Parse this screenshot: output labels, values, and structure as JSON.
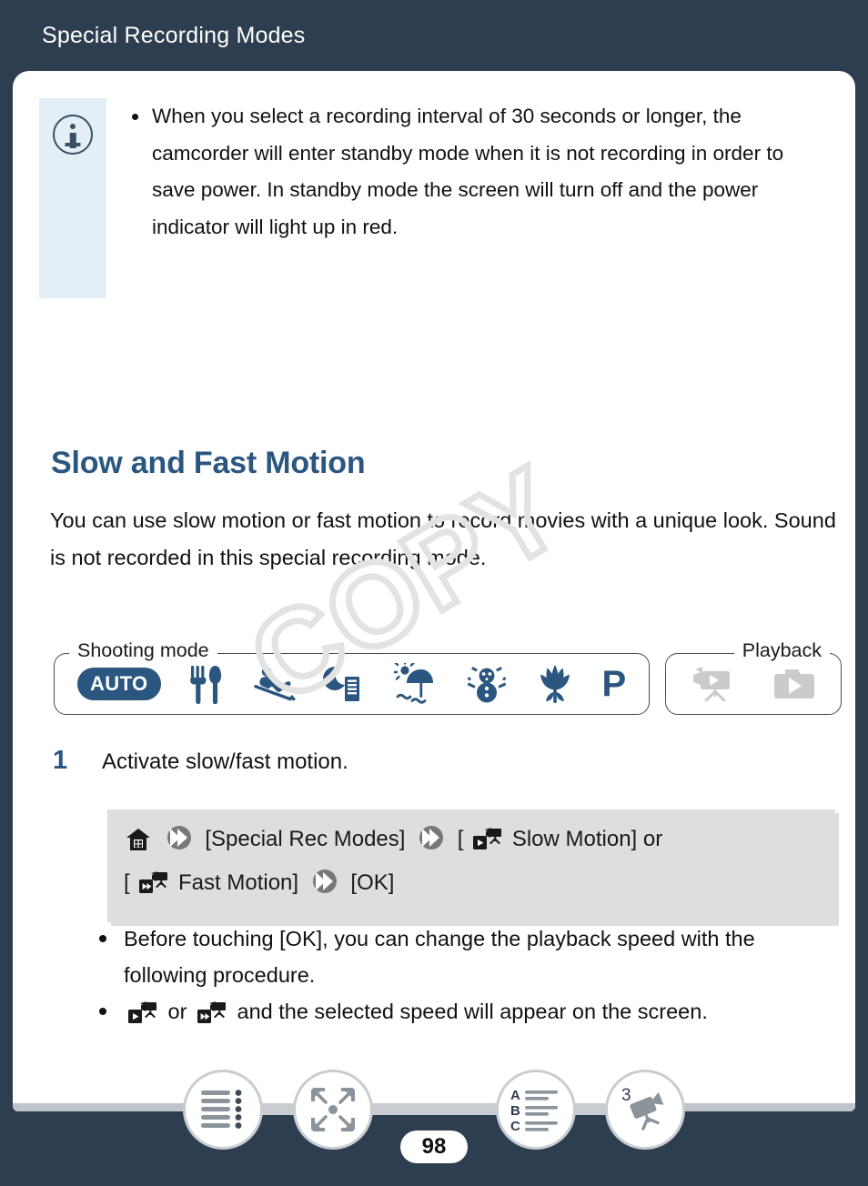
{
  "header": {
    "title": "Special Recording Modes"
  },
  "note": {
    "icon": "info-icon",
    "bullets": [
      "When you select a recording interval of 30 seconds or longer, the camcorder will enter standby mode when it is not recording in order to save power. In standby mode the screen will turn off and the power indicator will light up in red."
    ]
  },
  "section": {
    "heading": "Slow and Fast Motion",
    "intro": "You can use slow motion or fast motion to record movies with a unique look. Sound is not recorded in this special recording mode."
  },
  "mode_bar": {
    "shooting_label": "Shooting mode",
    "playback_label": "Playback",
    "shooting_icons": [
      {
        "name": "auto-mode-icon",
        "label": "AUTO"
      },
      {
        "name": "food-mode-icon",
        "label": ""
      },
      {
        "name": "sports-mode-icon",
        "label": ""
      },
      {
        "name": "night-scene-mode-icon",
        "label": ""
      },
      {
        "name": "beach-mode-icon",
        "label": ""
      },
      {
        "name": "snow-mode-icon",
        "label": ""
      },
      {
        "name": "macro-flower-mode-icon",
        "label": ""
      },
      {
        "name": "program-mode-icon",
        "label": "P"
      }
    ],
    "playback_icons": [
      {
        "name": "movie-playback-icon",
        "label": ""
      },
      {
        "name": "photo-playback-icon",
        "label": ""
      }
    ]
  },
  "step": {
    "number": "1",
    "text": "Activate slow/fast motion."
  },
  "procedure": {
    "line1_part1": "[Special Rec Modes]",
    "line1_part2": "Slow Motion] or",
    "line1_open_bracket": "[",
    "line2_open_bracket": "[",
    "line2_part1": "Fast Motion]",
    "line2_part2": "[OK]"
  },
  "sub_bullets": [
    "Before touching [OK], you can change the playback speed with the following procedure.",
    "or and the selected speed will appear on the screen."
  ],
  "sub_bullet2": {
    "middle": "or",
    "tail": "and the selected speed will appear on the screen."
  },
  "watermark": {
    "text": "COPY"
  },
  "bottom_nav": {
    "page_number": "98",
    "buttons": [
      {
        "name": "table-of-contents-button",
        "label": ""
      },
      {
        "name": "fullscreen-button",
        "label": ""
      },
      {
        "name": "alphabetical-index-button",
        "label": "ABC"
      },
      {
        "name": "camcorder-chapter-button",
        "label": "3"
      }
    ]
  },
  "colors": {
    "background": "#2d3e50",
    "accent_blue": "#2a5680",
    "note_panel": "#e3eef7",
    "procedure_box": "#dcdedf",
    "playback_icon_grey": "#c9cbcd"
  }
}
